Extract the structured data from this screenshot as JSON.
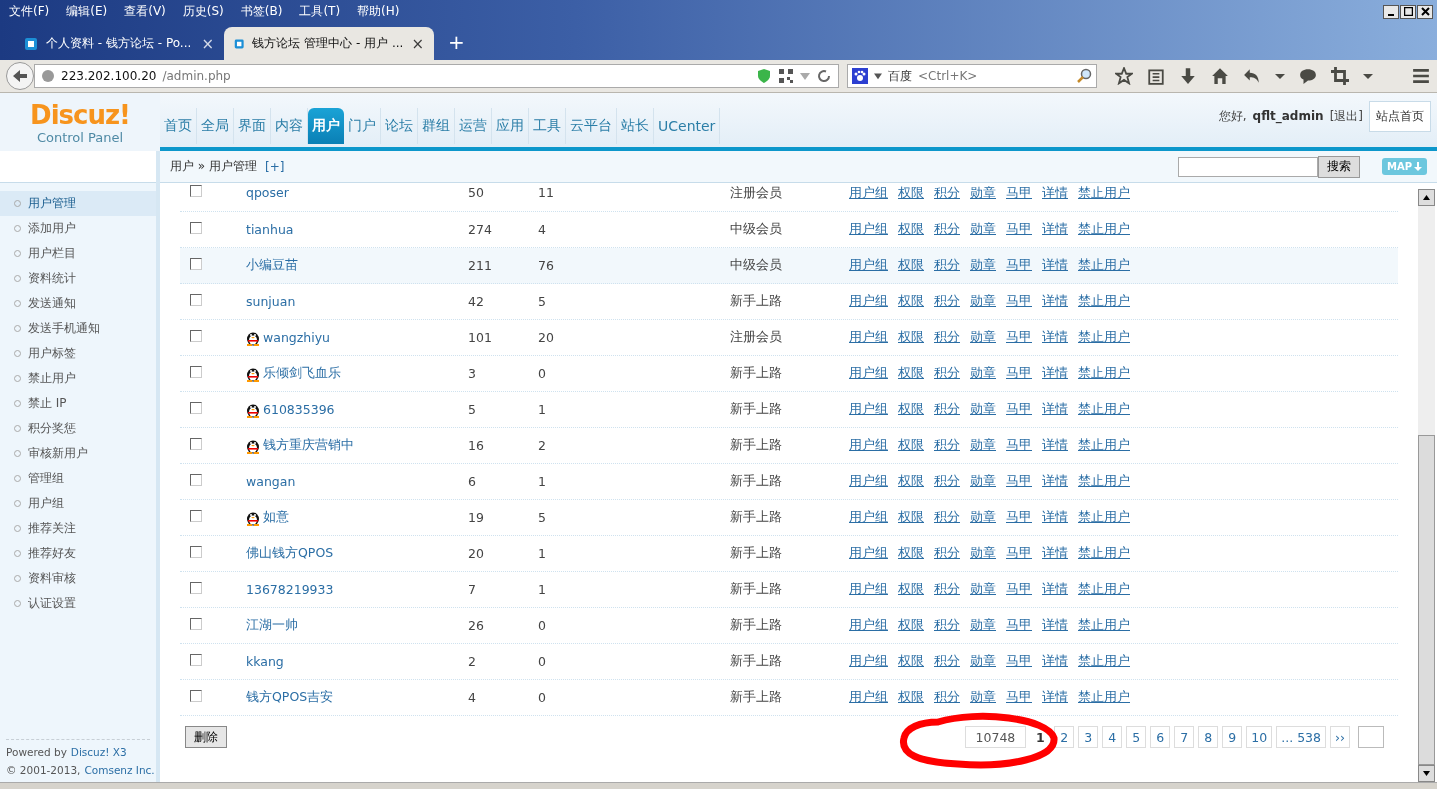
{
  "menu_bar": [
    "文件(F)",
    "编辑(E)",
    "查看(V)",
    "历史(S)",
    "书签(B)",
    "工具(T)",
    "帮助(H)"
  ],
  "tabs": [
    {
      "title": "个人资料 - 钱方论坛 - Po...",
      "close": "×",
      "selected": false
    },
    {
      "title": "钱方论坛 管理中心 - 用户 ...",
      "close": "×",
      "selected": true
    }
  ],
  "new_tab": "+",
  "address": {
    "host": "223.202.100.20",
    "path": "/admin.php"
  },
  "search_engine": {
    "name": "百度",
    "placeholder": "<Ctrl+K>"
  },
  "logo": {
    "brand": "Discuz!",
    "subtitle": "Control Panel"
  },
  "nav": [
    {
      "label": "首页",
      "selected": false
    },
    {
      "label": "全局",
      "selected": false
    },
    {
      "label": "界面",
      "selected": false
    },
    {
      "label": "内容",
      "selected": false
    },
    {
      "label": "用户",
      "selected": true
    },
    {
      "label": "门户",
      "selected": false
    },
    {
      "label": "论坛",
      "selected": false
    },
    {
      "label": "群组",
      "selected": false
    },
    {
      "label": "运营",
      "selected": false
    },
    {
      "label": "应用",
      "selected": false
    },
    {
      "label": "工具",
      "selected": false
    },
    {
      "label": "云平台",
      "selected": false
    },
    {
      "label": "站长",
      "selected": false
    },
    {
      "label": "UCenter",
      "selected": false
    }
  ],
  "user": {
    "greeting": "您好,",
    "name": "qflt_admin",
    "logout": "[退出]",
    "home": "站点首页"
  },
  "breadcrumb": {
    "path": "用户 » 用户管理",
    "add": "[+]"
  },
  "search_button": "搜索",
  "map_button": "MAP",
  "sidebar": [
    {
      "label": "用户管理",
      "selected": true
    },
    {
      "label": "添加用户",
      "selected": false
    },
    {
      "label": "用户栏目",
      "selected": false
    },
    {
      "label": "资料统计",
      "selected": false
    },
    {
      "label": "发送通知",
      "selected": false
    },
    {
      "label": "发送手机通知",
      "selected": false
    },
    {
      "label": "用户标签",
      "selected": false
    },
    {
      "label": "禁止用户",
      "selected": false
    },
    {
      "label": "禁止 IP",
      "selected": false
    },
    {
      "label": "积分奖惩",
      "selected": false
    },
    {
      "label": "审核新用户",
      "selected": false
    },
    {
      "label": "管理组",
      "selected": false
    },
    {
      "label": "用户组",
      "selected": false
    },
    {
      "label": "推荐关注",
      "selected": false
    },
    {
      "label": "推荐好友",
      "selected": false
    },
    {
      "label": "资料审核",
      "selected": false
    },
    {
      "label": "认证设置",
      "selected": false
    }
  ],
  "footer": {
    "powered": "Powered by",
    "product": "Discuz! X3",
    "copyright": "© 2001-2013,",
    "company": "Comsenz Inc."
  },
  "rows": [
    {
      "name": "qposer",
      "qq": false,
      "posts": "50",
      "credits": "11",
      "group": "注册会员",
      "checked": false,
      "highlighted": false,
      "actions": [
        "用户组",
        "权限",
        "积分",
        "勋章",
        "马甲",
        "详情",
        "禁止用户"
      ]
    },
    {
      "name": "tianhua",
      "qq": false,
      "posts": "274",
      "credits": "4",
      "group": "中级会员",
      "checked": false,
      "highlighted": false,
      "actions": [
        "用户组",
        "权限",
        "积分",
        "勋章",
        "马甲",
        "详情",
        "禁止用户"
      ]
    },
    {
      "name": "小编豆苗",
      "qq": false,
      "posts": "211",
      "credits": "76",
      "group": "中级会员",
      "checked": false,
      "highlighted": true,
      "actions": [
        "用户组",
        "权限",
        "积分",
        "勋章",
        "马甲",
        "详情",
        "禁止用户"
      ]
    },
    {
      "name": "sunjuan",
      "qq": false,
      "posts": "42",
      "credits": "5",
      "group": "新手上路",
      "checked": false,
      "highlighted": false,
      "actions": [
        "用户组",
        "权限",
        "积分",
        "勋章",
        "马甲",
        "详情",
        "禁止用户"
      ]
    },
    {
      "name": "wangzhiyu",
      "qq": true,
      "posts": "101",
      "credits": "20",
      "group": "注册会员",
      "checked": false,
      "highlighted": false,
      "actions": [
        "用户组",
        "权限",
        "积分",
        "勋章",
        "马甲",
        "详情",
        "禁止用户"
      ]
    },
    {
      "name": "乐倾剑飞血乐",
      "qq": true,
      "posts": "3",
      "credits": "0",
      "group": "新手上路",
      "checked": false,
      "highlighted": false,
      "actions": [
        "用户组",
        "权限",
        "积分",
        "勋章",
        "马甲",
        "详情",
        "禁止用户"
      ]
    },
    {
      "name": "610835396",
      "qq": true,
      "posts": "5",
      "credits": "1",
      "group": "新手上路",
      "checked": false,
      "highlighted": false,
      "actions": [
        "用户组",
        "权限",
        "积分",
        "勋章",
        "马甲",
        "详情",
        "禁止用户"
      ]
    },
    {
      "name": "钱方重庆营销中",
      "qq": true,
      "posts": "16",
      "credits": "2",
      "group": "新手上路",
      "checked": false,
      "highlighted": false,
      "actions": [
        "用户组",
        "权限",
        "积分",
        "勋章",
        "马甲",
        "详情",
        "禁止用户"
      ]
    },
    {
      "name": "wangan",
      "qq": false,
      "posts": "6",
      "credits": "1",
      "group": "新手上路",
      "checked": false,
      "highlighted": false,
      "actions": [
        "用户组",
        "权限",
        "积分",
        "勋章",
        "马甲",
        "详情",
        "禁止用户"
      ]
    },
    {
      "name": "如意",
      "qq": true,
      "posts": "19",
      "credits": "5",
      "group": "新手上路",
      "checked": false,
      "highlighted": false,
      "actions": [
        "用户组",
        "权限",
        "积分",
        "勋章",
        "马甲",
        "详情",
        "禁止用户"
      ]
    },
    {
      "name": "佛山钱方QPOS",
      "qq": false,
      "posts": "20",
      "credits": "1",
      "group": "新手上路",
      "checked": false,
      "highlighted": false,
      "actions": [
        "用户组",
        "权限",
        "积分",
        "勋章",
        "马甲",
        "详情",
        "禁止用户"
      ]
    },
    {
      "name": "13678219933",
      "qq": false,
      "posts": "7",
      "credits": "1",
      "group": "新手上路",
      "checked": false,
      "highlighted": false,
      "actions": [
        "用户组",
        "权限",
        "积分",
        "勋章",
        "马甲",
        "详情",
        "禁止用户"
      ]
    },
    {
      "name": "江湖一帅",
      "qq": false,
      "posts": "26",
      "credits": "0",
      "group": "新手上路",
      "checked": false,
      "highlighted": false,
      "actions": [
        "用户组",
        "权限",
        "积分",
        "勋章",
        "马甲",
        "详情",
        "禁止用户"
      ]
    },
    {
      "name": "kkang",
      "qq": false,
      "posts": "2",
      "credits": "0",
      "group": "新手上路",
      "checked": false,
      "highlighted": false,
      "actions": [
        "用户组",
        "权限",
        "积分",
        "勋章",
        "马甲",
        "详情",
        "禁止用户"
      ]
    },
    {
      "name": "钱方QPOS吉安",
      "qq": false,
      "posts": "4",
      "credits": "0",
      "group": "新手上路",
      "checked": false,
      "highlighted": false,
      "actions": [
        "用户组",
        "权限",
        "积分",
        "勋章",
        "马甲",
        "详情",
        "禁止用户"
      ]
    }
  ],
  "delete_button": "删除",
  "pagination": {
    "total": "10748",
    "pages": [
      {
        "label": "1",
        "selected": true
      },
      {
        "label": "2",
        "selected": false
      },
      {
        "label": "3",
        "selected": false
      },
      {
        "label": "4",
        "selected": false
      },
      {
        "label": "5",
        "selected": false
      },
      {
        "label": "6",
        "selected": false
      },
      {
        "label": "7",
        "selected": false
      },
      {
        "label": "8",
        "selected": false
      },
      {
        "label": "9",
        "selected": false
      },
      {
        "label": "10",
        "selected": false
      },
      {
        "label": "... 538",
        "selected": false
      },
      {
        "label": "››",
        "selected": false
      }
    ]
  },
  "annotation": {
    "kind": "circle",
    "color": "#ff0000"
  }
}
